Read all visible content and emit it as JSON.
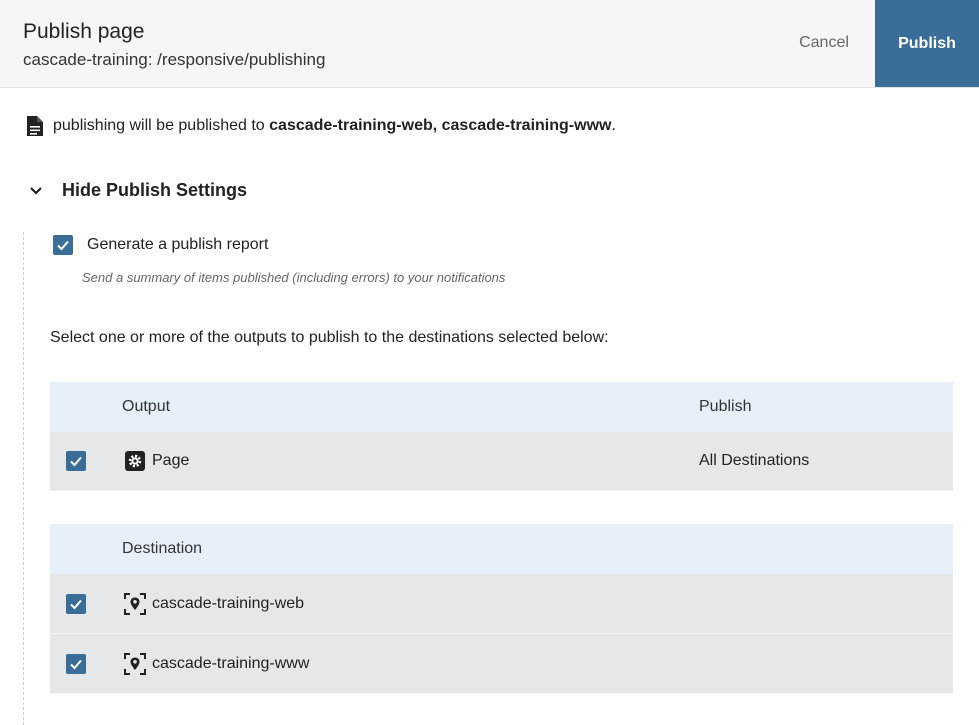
{
  "header": {
    "title": "Publish page",
    "path": "cascade-training: /responsive/publishing",
    "cancel_label": "Cancel",
    "publish_label": "Publish",
    "accent_color": "#3a6e98"
  },
  "info": {
    "prefix": "publishing will be published to ",
    "destinations": "cascade-training-web, cascade-training-www",
    "suffix": "."
  },
  "settings": {
    "toggle_label": "Hide Publish Settings",
    "report_label": "Generate a publish report",
    "report_checked": true,
    "report_help": "Send a summary of items published (including errors) to your notifications",
    "select_text": "Select one or more of the outputs to publish to the destinations selected below:"
  },
  "outputs_table": {
    "headers": {
      "output": "Output",
      "publish": "Publish"
    },
    "rows": [
      {
        "icon": "gear-icon",
        "name": "Page",
        "publish": "All Destinations",
        "checked": true
      }
    ]
  },
  "destinations_table": {
    "headers": {
      "destination": "Destination"
    },
    "rows": [
      {
        "icon": "location-target-icon",
        "name": "cascade-training-web",
        "checked": true
      },
      {
        "icon": "location-target-icon",
        "name": "cascade-training-www",
        "checked": true
      }
    ]
  }
}
